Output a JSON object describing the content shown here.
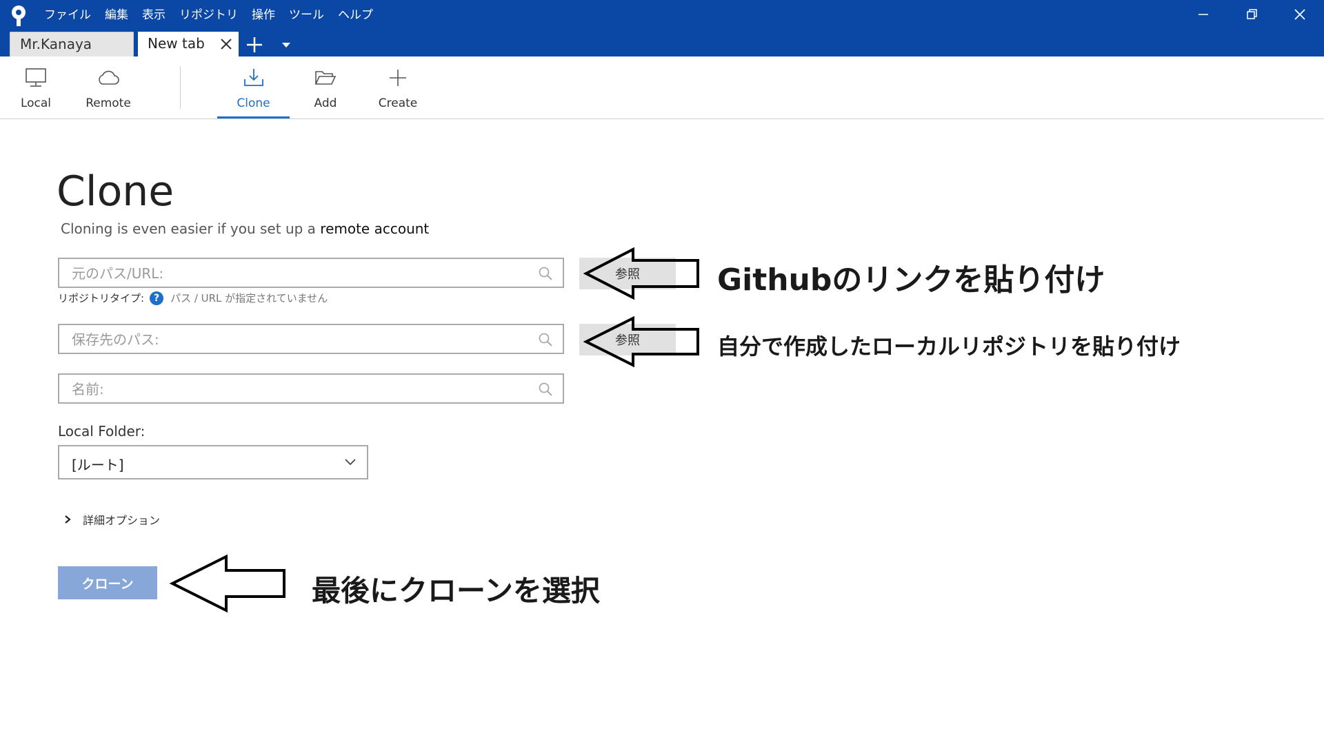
{
  "app": {
    "menu": [
      "ファイル",
      "編集",
      "表示",
      "リポジトリ",
      "操作",
      "ツール",
      "ヘルプ"
    ]
  },
  "tabs": [
    {
      "label": "Mr.Kanaya"
    },
    {
      "label": "New tab"
    }
  ],
  "toolbar": {
    "items": [
      {
        "label": "Local",
        "icon": "monitor-icon"
      },
      {
        "label": "Remote",
        "icon": "cloud-icon"
      },
      {
        "label": "Clone",
        "icon": "download-icon"
      },
      {
        "label": "Add",
        "icon": "folder-open-icon"
      },
      {
        "label": "Create",
        "icon": "plus-icon"
      }
    ],
    "active": "Clone",
    "accent_color": "#1e6fc8"
  },
  "page": {
    "title": "Clone",
    "subtitle_prefix": "Cloning is even easier if you set up a",
    "subtitle_link": "remote account"
  },
  "form": {
    "source_placeholder": "元のパス/URL:",
    "repo_type_label": "リポジトリタイプ:",
    "repo_type_help": "?",
    "repo_type_status": "パス / URL が指定されていません",
    "dest_placeholder": "保存先のパス:",
    "name_placeholder": "名前:",
    "browse_label": "参照",
    "local_folder_label": "Local Folder:",
    "local_folder_value": "[ルート]",
    "advanced_options": "詳細オプション",
    "clone_button": "クローン",
    "clone_button_color": "#86a7d8"
  },
  "annotations": {
    "source_note": "Githubのリンクを貼り付け",
    "dest_note": "自分で作成したローカルリポジトリを貼り付け",
    "clone_note": "最後にクローンを選択"
  },
  "colors": {
    "titlebar": "#0b48a6"
  }
}
